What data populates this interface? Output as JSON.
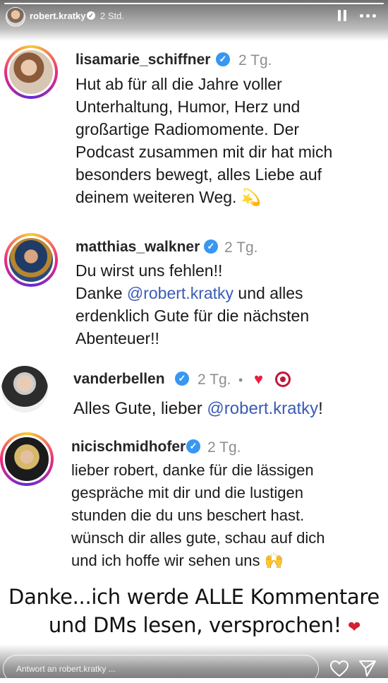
{
  "story": {
    "username": "robert.kratky",
    "time": "2 Std.",
    "progress_fraction": 1.0,
    "reply_placeholder": "Antwort an robert.kratky ...",
    "icons": [
      "pause-icon",
      "more-icon",
      "heart-icon",
      "paper-plane-icon",
      "verified-icon"
    ]
  },
  "comments": [
    {
      "username": "lisamarie_schiffner",
      "time": "2 Tg.",
      "text": "Hut ab für all die Jahre voller\nUnterhaltung, Humor, Herz und\ngroßartige Radiomomente. Der\nPodcast zusammen mit dir hat mich\nbesonders bewegt, alles Liebe auf\ndeinem weiteren Weg. 💫"
    },
    {
      "username": "matthias_walkner",
      "time": "2 Tg.",
      "text_line1": "Du wirst uns fehlen!!",
      "text_before": "Danke ",
      "mention": "@robert.kratky",
      "text_after": " und alles\nerdenklich Gute für die nächsten\nAbenteuer!!"
    },
    {
      "username": "vanderbellen",
      "time": "2 Tg.",
      "separator": "•",
      "liked": true,
      "text_before": "Alles Gute, lieber ",
      "mention": "@robert.kratky",
      "text_after": "!"
    },
    {
      "username": "nicischmidhofer",
      "time": "2 Tg.",
      "text": "lieber robert, danke für die lässigen\ngespräche mit dir und die lustigen\nstunden die du uns beschert hast.\nwünsch dir alles gute, schau auf dich\nund ich hoffe wir sehen uns 🙌"
    }
  ],
  "caption": {
    "line1": "Danke...ich werde ALLE Kommentare",
    "line2": "und DMs lesen, versprochen! ",
    "heart": "❤"
  },
  "colors": {
    "verified": "#3897f0",
    "mention": "#3a5cb7",
    "heart": "#ed1c40"
  }
}
